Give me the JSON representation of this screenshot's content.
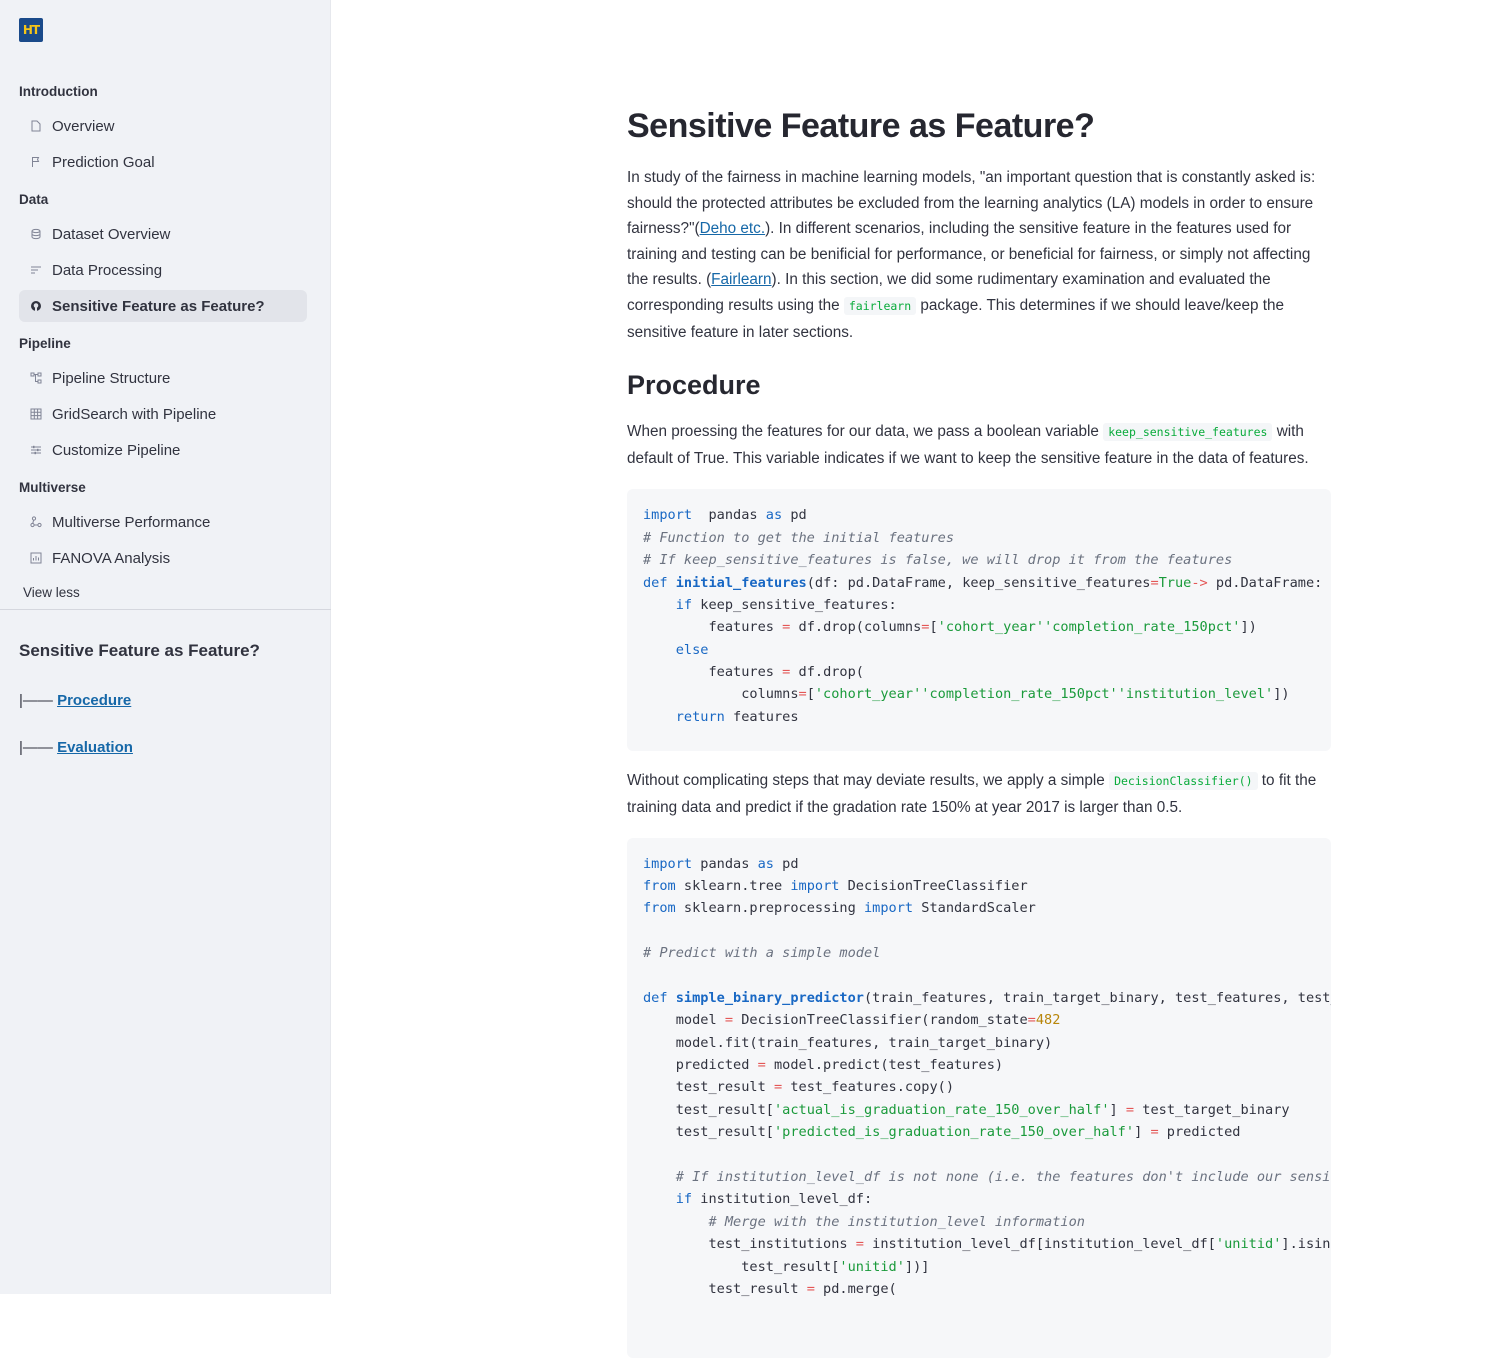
{
  "app": {
    "logo_text": "HT"
  },
  "sidebar": {
    "sections": [
      {
        "title": "Introduction",
        "items": [
          {
            "label": "Overview",
            "icon": "page-icon"
          },
          {
            "label": "Prediction Goal",
            "icon": "flag-icon"
          }
        ]
      },
      {
        "title": "Data",
        "items": [
          {
            "label": "Dataset Overview",
            "icon": "database-icon"
          },
          {
            "label": "Data Processing",
            "icon": "sort-lines-icon"
          },
          {
            "label": "Sensitive Feature as Feature?",
            "icon": "github-icon",
            "active": true
          }
        ]
      },
      {
        "title": "Pipeline",
        "items": [
          {
            "label": "Pipeline Structure",
            "icon": "tree-icon"
          },
          {
            "label": "GridSearch with Pipeline",
            "icon": "grid-icon"
          },
          {
            "label": "Customize Pipeline",
            "icon": "sliders-icon"
          }
        ]
      },
      {
        "title": "Multiverse",
        "items": [
          {
            "label": "Multiverse Performance",
            "icon": "nodes-icon"
          },
          {
            "label": "FANOVA Analysis",
            "icon": "chart-box-icon"
          }
        ]
      }
    ],
    "view_less": "View less",
    "toc": {
      "title": "Sensitive Feature as Feature?",
      "prefix": "|—— ",
      "links": [
        "Procedure",
        "Evaluation"
      ]
    }
  },
  "main": {
    "title": "Sensitive Feature as Feature?",
    "intro": {
      "part1": "In study of the fairness in machine learning models, \"an important question that is constantly asked is: should the protected attributes be excluded from the learning analytics (LA) models in order to ensure fairness?\"(",
      "link1": "Deho etc.",
      "part2": "). In different scenarios, including the sensitive feature in the features used for training and testing can be benificial for performance, or beneficial for fairness, or simply not affecting the results. (",
      "link2": "Fairlearn",
      "part3": "). In this section, we did some rudimentary examination and evaluated the corresponding results using the ",
      "code": "fairlearn",
      "part4": " package. This determines if we should leave/keep the sensitive feature in later sections."
    },
    "procedure_heading": "Procedure",
    "procedure_text": {
      "part1": "When proessing the features for our data, we pass a boolean variable ",
      "code": "keep_sensitive_features",
      "part2": " with default of True. This variable indicates if we want to keep the sensitive feature in the data of features."
    },
    "code1": [
      [
        [
          "k",
          "import"
        ],
        [
          "",
          "  pandas "
        ],
        [
          "k",
          "as"
        ],
        [
          "",
          " pd"
        ]
      ],
      [
        [
          "c",
          "# Function to get the initial features"
        ]
      ],
      [
        [
          "c",
          "# If keep_sensitive_features is false, we will drop it from the features"
        ]
      ],
      [
        [
          "k",
          "def"
        ],
        [
          "",
          " "
        ],
        [
          "fn",
          "initial_features"
        ],
        [
          "",
          "(df: pd.DataFrame, keep_sensitive_features"
        ],
        [
          "o",
          "="
        ],
        [
          "b",
          "True"
        ],
        [
          ") "
        ],
        [
          "o",
          "->"
        ],
        [
          "",
          " pd.DataFrame:"
        ]
      ],
      [
        [
          "",
          "    "
        ],
        [
          "k",
          "if"
        ],
        [
          "",
          " keep_sensitive_features:"
        ]
      ],
      [
        [
          "",
          "        features "
        ],
        [
          "o",
          "="
        ],
        [
          "",
          " df.drop(columns"
        ],
        [
          "o",
          "="
        ],
        [
          "",
          "["
        ],
        [
          "s",
          "'cohort_year'"
        ],
        [
          ", "
        ],
        [
          "s",
          "'completion_rate_150pct'"
        ],
        [
          "",
          "])"
        ]
      ],
      [
        [
          "",
          "    "
        ],
        [
          "k",
          "else"
        ],
        [
          ":"
        ]
      ],
      [
        [
          "",
          "        features "
        ],
        [
          "o",
          "="
        ],
        [
          "",
          " df.drop("
        ]
      ],
      [
        [
          "",
          "            columns"
        ],
        [
          "o",
          "="
        ],
        [
          "",
          "["
        ],
        [
          "s",
          "'cohort_year'"
        ],
        [
          ", "
        ],
        [
          "s",
          "'completion_rate_150pct'"
        ],
        [
          ", "
        ],
        [
          "s",
          "'institution_level'"
        ],
        [
          "",
          "])"
        ]
      ],
      [
        [
          "",
          "    "
        ],
        [
          "k",
          "return"
        ],
        [
          "",
          " features"
        ]
      ]
    ],
    "middle_text": {
      "part1": "Without complicating steps that may deviate results, we apply a simple ",
      "code": "DecisionClassifier()",
      "part2": " to fit the training data and predict if the gradation rate 150% at year 2017 is larger than 0.5."
    },
    "code2": [
      [
        [
          "k",
          "import"
        ],
        [
          "",
          " pandas "
        ],
        [
          "k",
          "as"
        ],
        [
          "",
          " pd"
        ]
      ],
      [
        [
          "k",
          "from"
        ],
        [
          "",
          " sklearn.tree "
        ],
        [
          "k",
          "import"
        ],
        [
          "",
          " DecisionTreeClassifier"
        ]
      ],
      [
        [
          "k",
          "from"
        ],
        [
          "",
          " sklearn.preprocessing "
        ],
        [
          "k",
          "import"
        ],
        [
          "",
          " StandardScaler"
        ]
      ],
      [
        [
          "",
          " "
        ]
      ],
      [
        [
          "c",
          "# Predict with a simple model"
        ]
      ],
      [
        [
          "",
          " "
        ]
      ],
      [
        [
          "k",
          "def"
        ],
        [
          "",
          " "
        ],
        [
          "fn",
          "simple_binary_predictor"
        ],
        [
          "",
          "(train_features, train_target_binary, test_features, test_target_binary, institution_level_df):"
        ]
      ],
      [
        [
          "",
          "    model "
        ],
        [
          "o",
          "="
        ],
        [
          "",
          " DecisionTreeClassifier(random_state"
        ],
        [
          "o",
          "="
        ],
        [
          "n",
          "482"
        ],
        [
          ")"
        ]
      ],
      [
        [
          "",
          "    model.fit(train_features, train_target_binary)"
        ]
      ],
      [
        [
          "",
          "    predicted "
        ],
        [
          "o",
          "="
        ],
        [
          "",
          " model.predict(test_features)"
        ]
      ],
      [
        [
          "",
          "    test_result "
        ],
        [
          "o",
          "="
        ],
        [
          "",
          " test_features.copy()"
        ]
      ],
      [
        [
          "",
          "    test_result["
        ],
        [
          "s",
          "'actual_is_graduation_rate_150_over_half'"
        ],
        [
          "",
          "] "
        ],
        [
          "o",
          "="
        ],
        [
          "",
          " test_target_binary"
        ]
      ],
      [
        [
          "",
          "    test_result["
        ],
        [
          "s",
          "'predicted_is_graduation_rate_150_over_half'"
        ],
        [
          "",
          "] "
        ],
        [
          "o",
          "="
        ],
        [
          "",
          " predicted"
        ]
      ],
      [
        [
          "",
          " "
        ]
      ],
      [
        [
          "",
          "    "
        ],
        [
          "c",
          "# If institution_level_df is not none (i.e. the features don't include our sensitive feature)"
        ]
      ],
      [
        [
          "",
          "    "
        ],
        [
          "k",
          "if"
        ],
        [
          "",
          " institution_level_df:"
        ]
      ],
      [
        [
          "",
          "        "
        ],
        [
          "c",
          "# Merge with the institution_level information"
        ]
      ],
      [
        [
          "",
          "        test_institutions "
        ],
        [
          "o",
          "="
        ],
        [
          "",
          " institution_level_df[institution_level_df["
        ],
        [
          "s",
          "'unitid'"
        ],
        [
          "",
          "].isin("
        ]
      ],
      [
        [
          "",
          "            test_result["
        ],
        [
          "s",
          "'unitid'"
        ],
        [
          "",
          "])]"
        ]
      ],
      [
        [
          "",
          "        test_result "
        ],
        [
          "o",
          "="
        ],
        [
          "",
          " pd.merge("
        ]
      ]
    ]
  }
}
